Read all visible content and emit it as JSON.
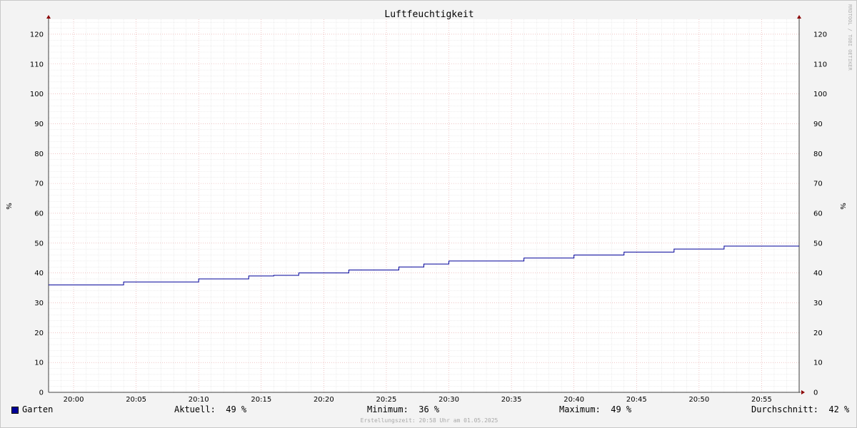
{
  "chart_data": {
    "type": "line",
    "title": "Luftfeuchtigkeit",
    "ylabel": "%",
    "ylim": [
      0,
      125
    ],
    "yticks": [
      0,
      10,
      20,
      30,
      40,
      50,
      60,
      70,
      80,
      90,
      100,
      110,
      120
    ],
    "xlim": [
      "19:58",
      "20:58"
    ],
    "xticks": [
      "20:00",
      "20:05",
      "20:10",
      "20:15",
      "20:20",
      "20:25",
      "20:30",
      "20:35",
      "20:40",
      "20:45",
      "20:50",
      "20:55"
    ],
    "grid": true,
    "series": [
      {
        "name": "Garten",
        "color": "#000099",
        "step": true,
        "x": [
          "19:58",
          "20:04",
          "20:10",
          "20:14",
          "20:16",
          "20:18",
          "20:22",
          "20:26",
          "20:28",
          "20:30",
          "20:36",
          "20:40",
          "20:44",
          "20:48",
          "20:52",
          "20:58"
        ],
        "values": [
          36,
          37,
          38,
          39,
          39.2,
          40,
          41,
          42,
          43,
          44,
          45,
          46,
          47,
          48,
          49,
          49
        ]
      }
    ]
  },
  "watermark": "RRDTOOL / TOBI OETIKER",
  "legend": {
    "series_name": "Garten",
    "aktuell_label": "Aktuell:",
    "aktuell_value": "49 %",
    "minimum_label": "Minimum:",
    "minimum_value": "36 %",
    "maximum_label": "Maximum:",
    "maximum_value": "49 %",
    "durchschnitt_label": "Durchschnitt:",
    "durchschnitt_value": "42 %"
  },
  "footer": "Erstellungszeit: 20:58 Uhr am 01.05.2025"
}
